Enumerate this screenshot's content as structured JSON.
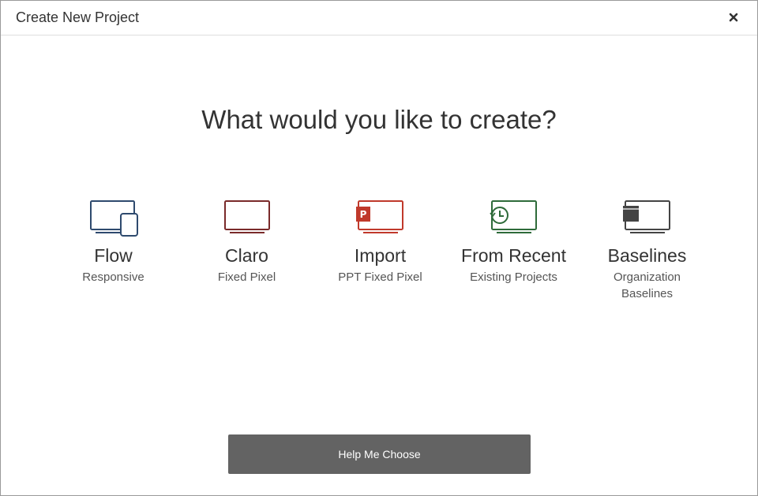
{
  "dialog": {
    "title": "Create New Project",
    "close_icon": "close-icon"
  },
  "main": {
    "heading": "What would you like to create?",
    "options": [
      {
        "title": "Flow",
        "subtitle": "Responsive",
        "icon": "responsive-devices-icon",
        "color": "#2e4a6e"
      },
      {
        "title": "Claro",
        "subtitle": "Fixed Pixel",
        "icon": "monitor-icon",
        "color": "#7a2a2a"
      },
      {
        "title": "Import",
        "subtitle": "PPT Fixed Pixel",
        "icon": "powerpoint-monitor-icon",
        "color": "#c0392b"
      },
      {
        "title": "From Recent",
        "subtitle": "Existing Projects",
        "icon": "history-monitor-icon",
        "color": "#2e6b3a"
      },
      {
        "title": "Baselines",
        "subtitle_lines": [
          "Organization",
          "Baselines"
        ],
        "icon": "baseline-monitor-icon",
        "color": "#444444"
      }
    ]
  },
  "footer": {
    "help_button": "Help Me Choose",
    "help_button_color": "#636363"
  }
}
